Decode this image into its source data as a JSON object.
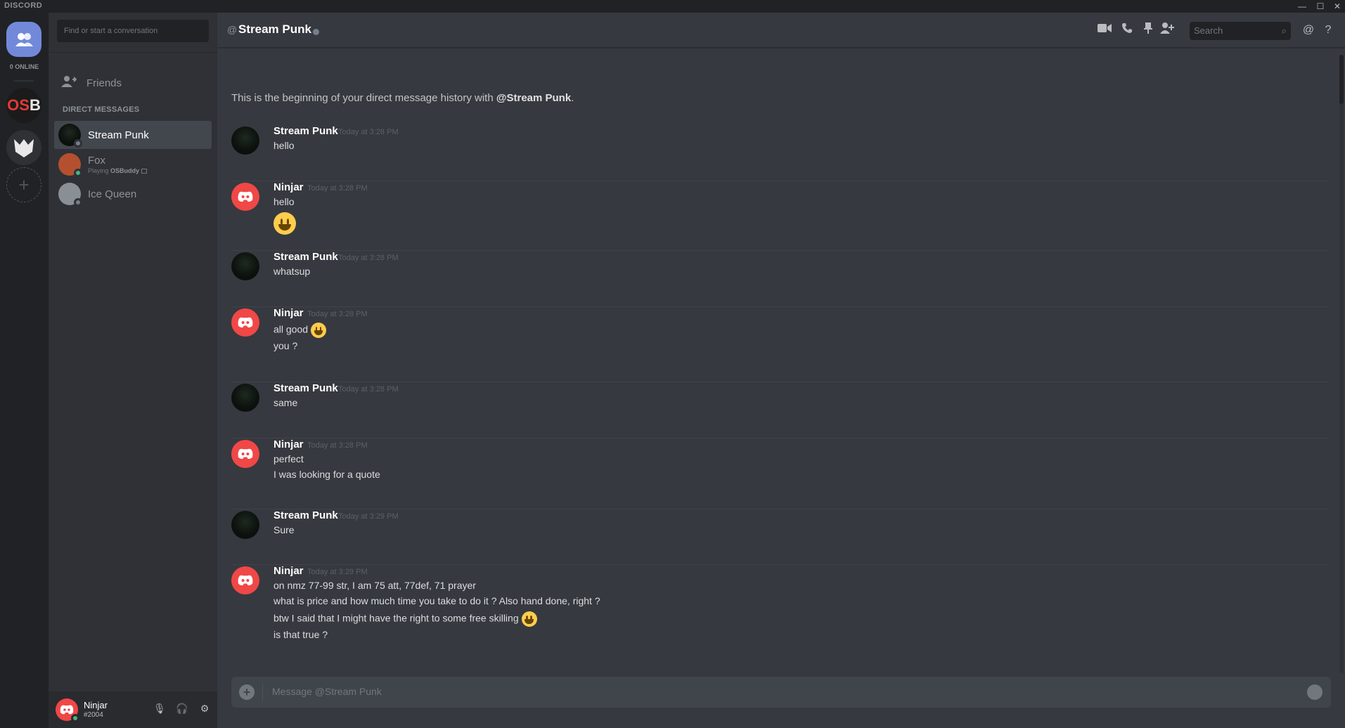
{
  "titlebar": {
    "brand": "DISCORD",
    "minimize": "—",
    "maximize": "☐",
    "close": "✕"
  },
  "guilds": {
    "online_count": "0 ONLINE",
    "osb_o": "OS",
    "osb_b": "B",
    "add": "+"
  },
  "sidebar": {
    "search_placeholder": "Find or start a conversation",
    "friends_label": "Friends",
    "dm_header": "DIRECT MESSAGES",
    "dms": [
      {
        "name": "Stream Punk",
        "status": "offline",
        "active": true
      },
      {
        "name": "Fox",
        "activity_prefix": "Playing ",
        "activity_game": "OSBuddy",
        "status": "online"
      },
      {
        "name": "Ice Queen",
        "status": "offline"
      }
    ]
  },
  "user": {
    "name": "Ninjar",
    "tag": "#2004"
  },
  "header": {
    "at": "@",
    "title": "Stream Punk",
    "search_placeholder": "Search"
  },
  "conversation": {
    "intro_prefix": "This is the beginning of your direct message history with ",
    "intro_user": "@Stream Punk",
    "intro_suffix": "."
  },
  "messages": [
    {
      "author": "Stream Punk",
      "time": "Today at 3:28 PM",
      "lines": [
        "hello"
      ]
    },
    {
      "author": "Ninjar",
      "time": "Today at 3:28 PM",
      "lines": [
        "hello"
      ]
    },
    {
      "author": "Stream Punk",
      "time": "Today at 3:28 PM",
      "lines": [
        "whatsup"
      ]
    },
    {
      "author": "Ninjar",
      "time": "Today at 3:28 PM",
      "lines": [
        "all good",
        "you ?"
      ]
    },
    {
      "author": "Stream Punk",
      "time": "Today at 3:28 PM",
      "lines": [
        "same"
      ]
    },
    {
      "author": "Ninjar",
      "time": "Today at 3:28 PM",
      "lines": [
        "perfect",
        "I was looking for a quote"
      ]
    },
    {
      "author": "Stream Punk",
      "time": "Today at 3:29 PM",
      "lines": [
        "Sure"
      ]
    },
    {
      "author": "Ninjar",
      "time": "Today at 3:29 PM",
      "lines": [
        "on nmz 77-99 str, I am 75 att, 77def, 71 prayer",
        "what is price and how much time you take to do it ? Also hand done, right ?",
        "btw I said that I might have the right to some free skilling",
        "is that true ?"
      ]
    }
  ],
  "composer": {
    "placeholder": "Message @Stream Punk"
  },
  "colors": {
    "blurple": "#7289da",
    "online": "#43b581",
    "ninjar_avatar": "#f04747"
  }
}
